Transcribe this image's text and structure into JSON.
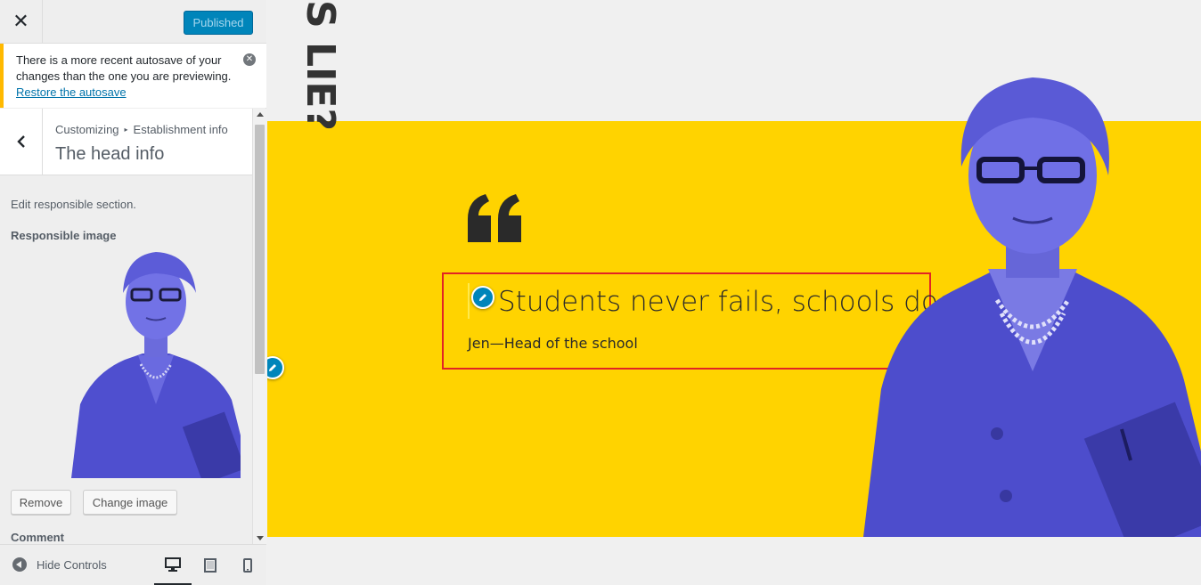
{
  "sidebar": {
    "close_glyph": "✕",
    "publish_label": "Published",
    "notice": {
      "text": "There is a more recent autosave of your changes than the one you are previewing.",
      "link": "Restore the autosave",
      "dismiss_glyph": "✕"
    },
    "panel": {
      "back_glyph": "‹",
      "breadcrumb": [
        "Customizing",
        "Establishment info"
      ],
      "breadcrumb_separator": "▸",
      "title": "The head info"
    },
    "section": {
      "description": "Edit responsible section.",
      "image_label": "Responsible image",
      "remove_label": "Remove",
      "change_label": "Change image",
      "comment_label": "Comment"
    },
    "footer": {
      "hide_label": "Hide Controls",
      "devices": [
        "desktop-icon",
        "tablet-icon",
        "mobile-icon"
      ],
      "active_device": "desktop"
    }
  },
  "preview": {
    "vertical_heading": "S LIE?",
    "quote": "Students never fails, schools does ...",
    "author": "Jen—Head of the school",
    "colors": {
      "band": "#ffd300",
      "portrait_tint": "#5a5ad6",
      "highlight": "#e22424",
      "accent": "#0085ba"
    }
  }
}
